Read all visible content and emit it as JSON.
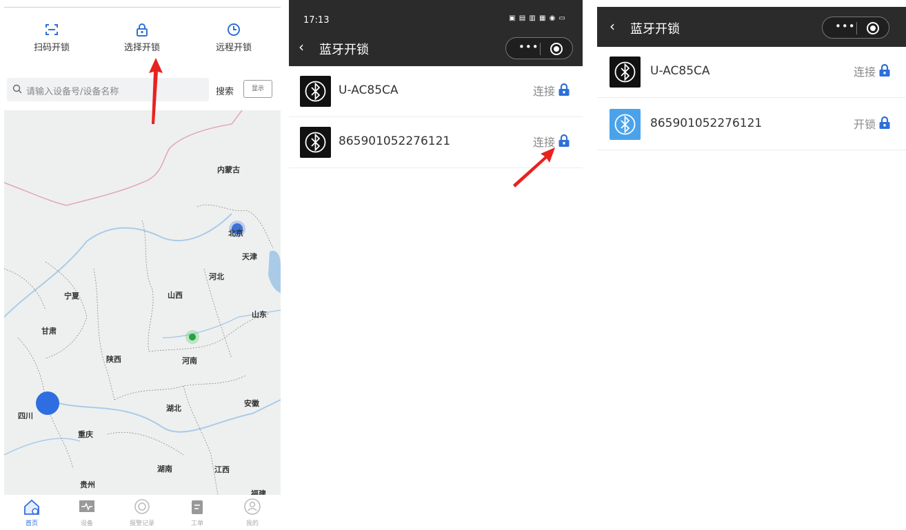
{
  "screen1": {
    "mode_tabs": [
      {
        "label": "扫码开锁",
        "icon": "scan-icon"
      },
      {
        "label": "选择开锁",
        "icon": "lock-icon"
      },
      {
        "label": "远程开锁",
        "icon": "clock-icon"
      }
    ],
    "search": {
      "placeholder": "请输入设备号/设备名称",
      "search_label": "搜索",
      "show_label": "显示"
    },
    "map_labels": {
      "neimenggu": "内蒙古",
      "beijing": "北京",
      "tianjin": "天津",
      "hebei": "河北",
      "ningxia": "宁夏",
      "shanxi": "山西",
      "shandong": "山东",
      "gansu": "甘肃",
      "shaanxi": "陕西",
      "henan": "河南",
      "sichuan": "四川",
      "hubei": "湖北",
      "anhui": "安徽",
      "chongqing": "重庆",
      "hunan": "湖南",
      "jiangxi": "江西",
      "guizhou": "贵州",
      "fujian": "福建"
    },
    "tabbar": [
      {
        "label": "首页",
        "icon": "home-icon",
        "active": true
      },
      {
        "label": "设备",
        "icon": "device-icon",
        "active": false
      },
      {
        "label": "报警记录",
        "icon": "alarm-icon",
        "active": false
      },
      {
        "label": "工单",
        "icon": "clipboard-icon",
        "active": false
      },
      {
        "label": "我的",
        "icon": "profile-icon",
        "active": false
      }
    ]
  },
  "screen2": {
    "status": {
      "time": "17:13"
    },
    "title": "蓝牙开锁",
    "devices": [
      {
        "name": "U-AC85CA",
        "action": "连接"
      },
      {
        "name": "865901052276121",
        "action": "连接"
      }
    ]
  },
  "screen3": {
    "title": "蓝牙开锁",
    "devices": [
      {
        "name": "U-AC85CA",
        "action": "连接"
      },
      {
        "name": "865901052276121",
        "action": "开锁"
      }
    ]
  },
  "colors": {
    "accent": "#2e6fd8",
    "dark_bar": "#2b2b2b",
    "bt_blue": "#4aa3ea",
    "arrow_red": "#e8221f"
  }
}
